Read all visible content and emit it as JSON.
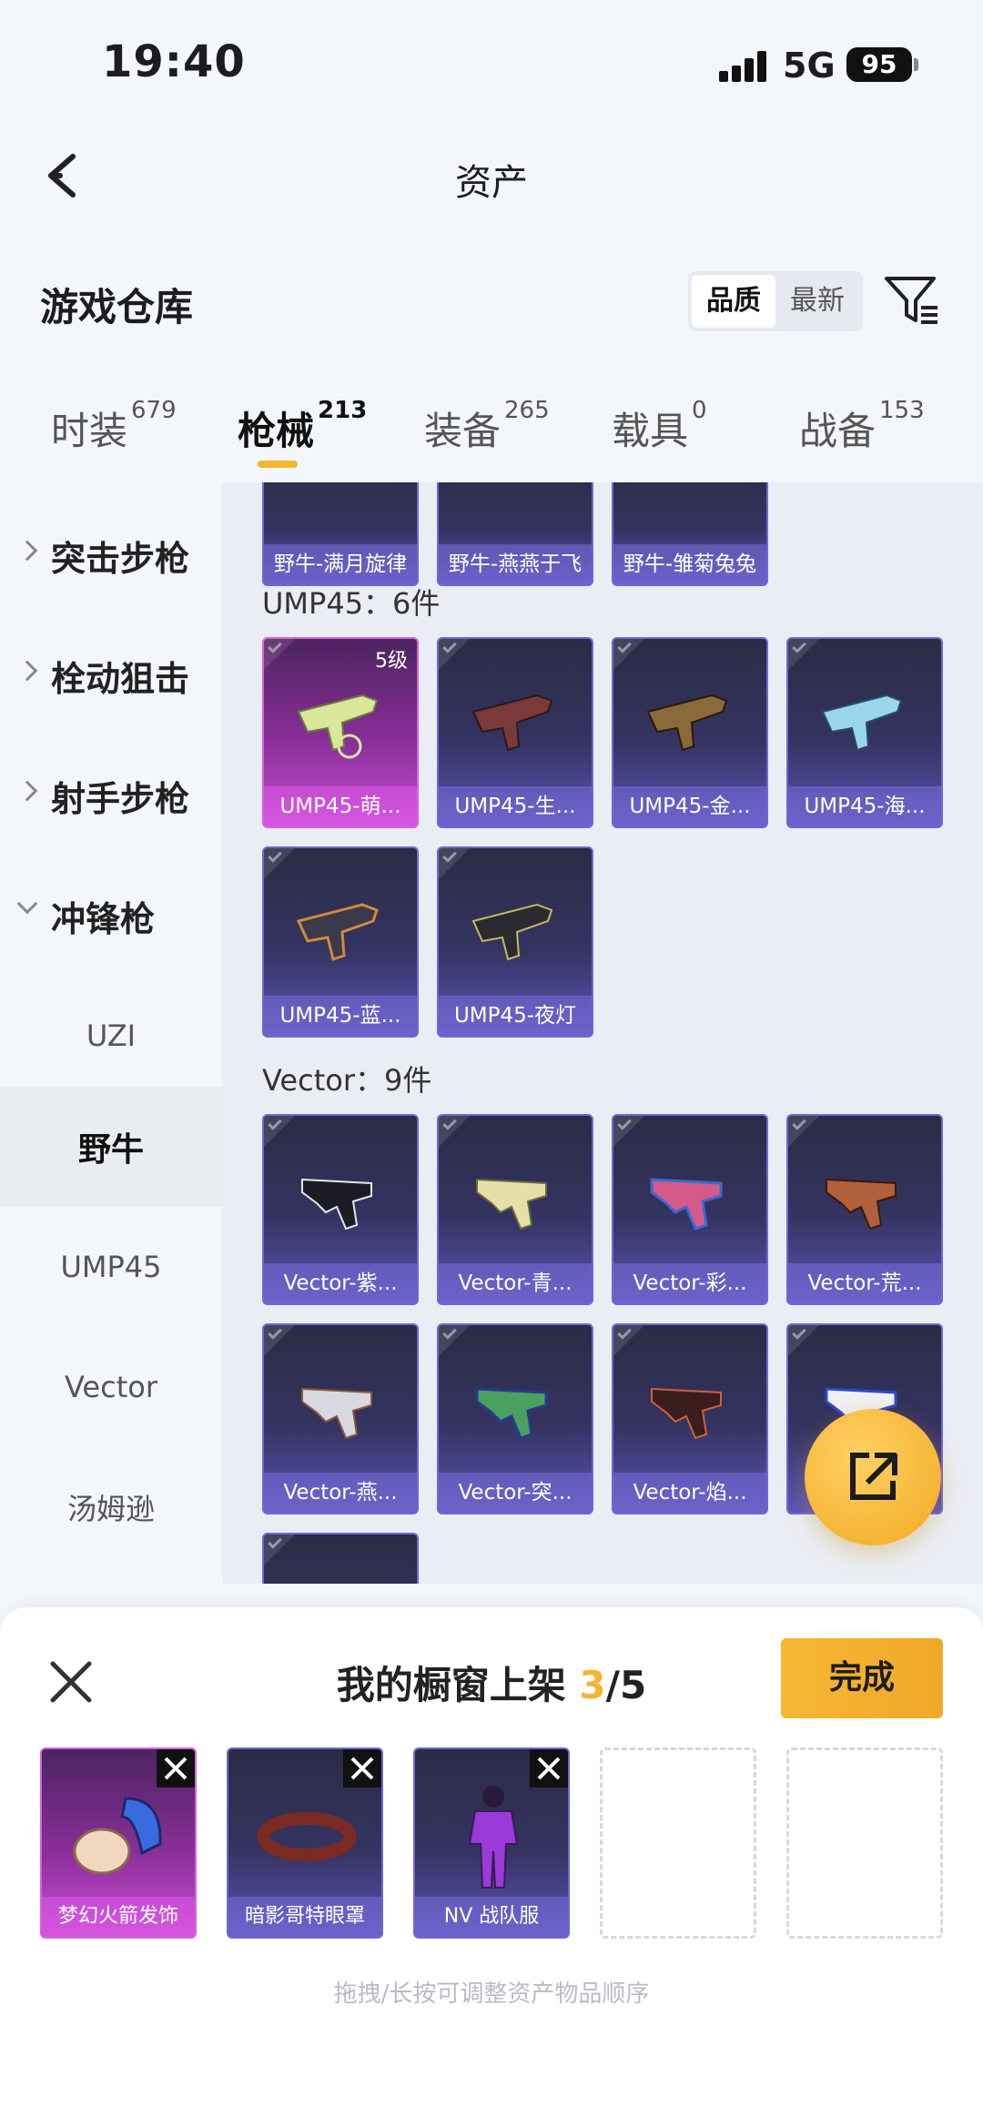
{
  "status": {
    "time": "19:40",
    "network": "5G",
    "battery": "95"
  },
  "nav": {
    "title": "资产"
  },
  "header": {
    "title": "游戏仓库",
    "sort_options": [
      "品质",
      "最新"
    ],
    "active_sort": "品质"
  },
  "tabs": [
    {
      "label": "时装",
      "count": "679"
    },
    {
      "label": "枪械",
      "count": "213",
      "active": true
    },
    {
      "label": "装备",
      "count": "265"
    },
    {
      "label": "载具",
      "count": "0"
    },
    {
      "label": "战备",
      "count": "153"
    }
  ],
  "sidebar": {
    "categories": [
      {
        "label": "突击步枪",
        "expanded": false
      },
      {
        "label": "栓动狙击",
        "expanded": false
      },
      {
        "label": "射手步枪",
        "expanded": false
      },
      {
        "label": "冲锋枪",
        "expanded": true
      }
    ],
    "subitems": [
      "UZI",
      "野牛",
      "UMP45",
      "Vector",
      "汤姆逊"
    ],
    "selected": "野牛"
  },
  "grid": {
    "top_row": [
      "野牛-满月旋律",
      "野牛-燕燕于飞",
      "野牛-雏菊兔兔"
    ],
    "groups": [
      {
        "title": "UMP45：6件",
        "items": [
          {
            "name": "UMP45-萌...",
            "level": "5级",
            "rarity": "gold"
          },
          {
            "name": "UMP45-生...",
            "rarity": "purple"
          },
          {
            "name": "UMP45-金...",
            "rarity": "purple"
          },
          {
            "name": "UMP45-海...",
            "rarity": "purple"
          },
          {
            "name": "UMP45-蓝...",
            "rarity": "purple"
          },
          {
            "name": "UMP45-夜灯",
            "rarity": "purple"
          }
        ]
      },
      {
        "title": "Vector：9件",
        "items": [
          {
            "name": "Vector-紫...",
            "rarity": "purple"
          },
          {
            "name": "Vector-青...",
            "rarity": "purple"
          },
          {
            "name": "Vector-彩...",
            "rarity": "purple"
          },
          {
            "name": "Vector-荒...",
            "rarity": "purple"
          },
          {
            "name": "Vector-燕...",
            "rarity": "purple"
          },
          {
            "name": "Vector-突...",
            "rarity": "purple"
          },
          {
            "name": "Vector-焰...",
            "rarity": "purple"
          },
          {
            "name": "",
            "rarity": "purple"
          },
          {
            "name": "",
            "rarity": "purple"
          }
        ]
      }
    ]
  },
  "sheet": {
    "title": "我的橱窗上架",
    "count_current": "3",
    "count_total": "/5",
    "done_label": "完成",
    "slots": [
      {
        "name": "梦幻火箭发饰",
        "rarity": "gold"
      },
      {
        "name": "暗影哥特眼罩",
        "rarity": "purple"
      },
      {
        "name": "NV 战队服",
        "rarity": "purple"
      },
      {
        "name": "",
        "rarity": "empty"
      },
      {
        "name": "",
        "rarity": "empty"
      }
    ],
    "hint": "拖拽/长按可调整资产物品顺序"
  },
  "colors": {
    "accent": "#f2b632",
    "purple": "#6f66d8",
    "gold_rarity": "#d464e0"
  }
}
